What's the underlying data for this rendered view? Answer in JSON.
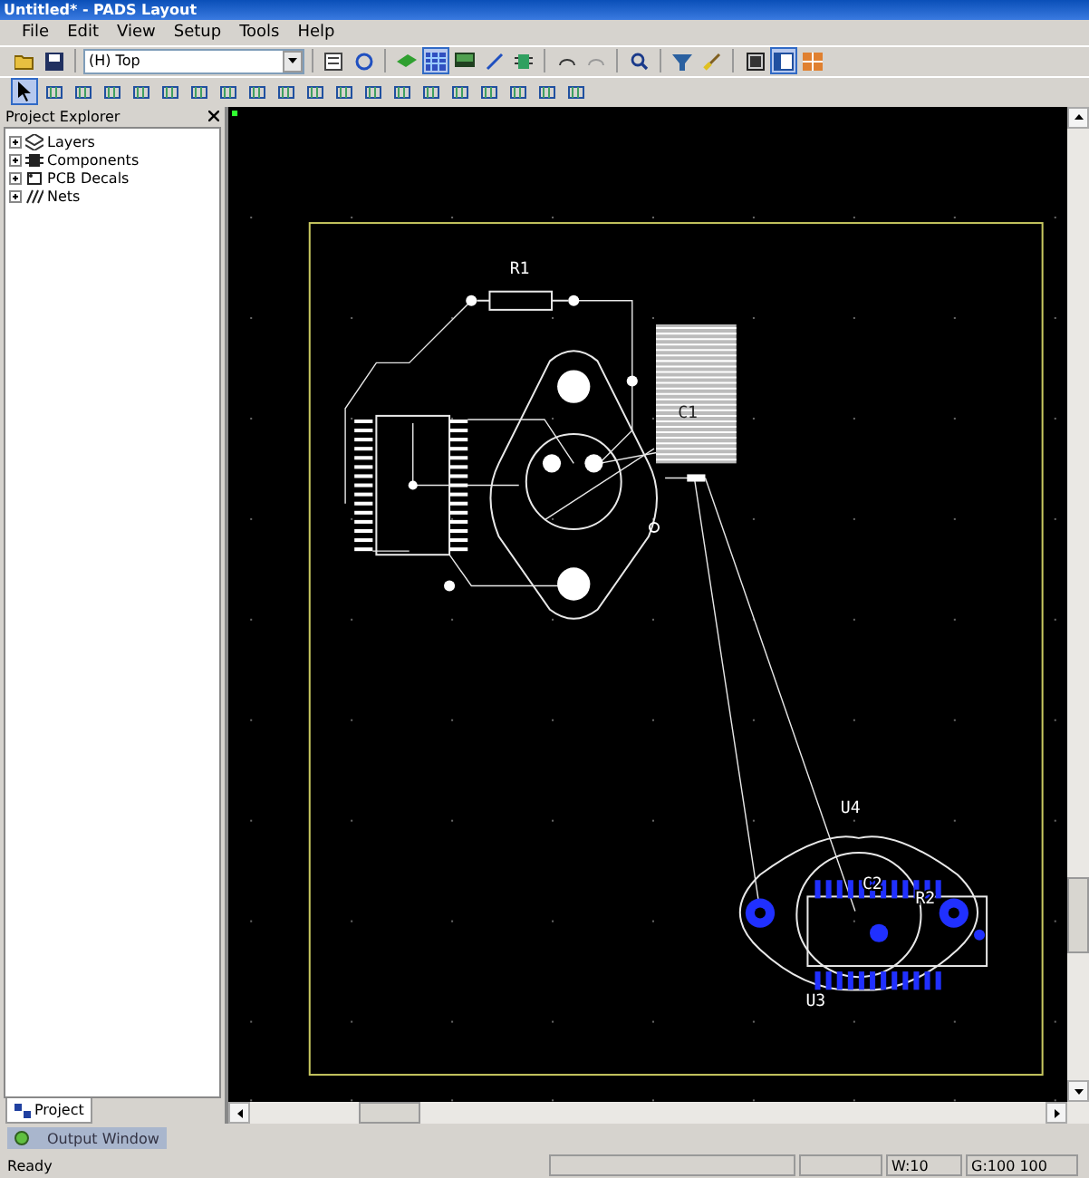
{
  "window": {
    "title": "Untitled* - PADS Layout"
  },
  "menu": [
    "File",
    "Edit",
    "View",
    "Setup",
    "Tools",
    "Help"
  ],
  "toolbar_1": [
    {
      "kind": "open",
      "pressed": false
    },
    {
      "kind": "save",
      "pressed": false
    },
    {
      "kind": "sep"
    },
    {
      "kind": "layer"
    },
    {
      "kind": "sep"
    },
    {
      "kind": "props",
      "pressed": false
    },
    {
      "kind": "refresh",
      "pressed": false
    },
    {
      "kind": "sep"
    },
    {
      "kind": "board",
      "pressed": false
    },
    {
      "kind": "grid",
      "pressed": true
    },
    {
      "kind": "display",
      "pressed": false
    },
    {
      "kind": "route",
      "pressed": false
    },
    {
      "kind": "part",
      "pressed": false
    },
    {
      "kind": "sep"
    },
    {
      "kind": "undo",
      "pressed": false
    },
    {
      "kind": "redo",
      "pressed": false
    },
    {
      "kind": "sep"
    },
    {
      "kind": "zoom",
      "pressed": false
    },
    {
      "kind": "sep"
    },
    {
      "kind": "filter",
      "pressed": false
    },
    {
      "kind": "brush",
      "pressed": false
    },
    {
      "kind": "sep"
    },
    {
      "kind": "window",
      "pressed": false
    },
    {
      "kind": "panes",
      "pressed": true
    },
    {
      "kind": "tile",
      "pressed": false
    }
  ],
  "layer_select": {
    "value": "(H) Top"
  },
  "toolbar_2": [
    {
      "kind": "select",
      "pressed": true
    },
    {
      "kind": "tool",
      "pressed": false
    },
    {
      "kind": "tool",
      "pressed": false
    },
    {
      "kind": "tool",
      "pressed": false
    },
    {
      "kind": "tool",
      "pressed": false
    },
    {
      "kind": "tool",
      "pressed": false
    },
    {
      "kind": "tool",
      "pressed": false
    },
    {
      "kind": "tool",
      "pressed": false
    },
    {
      "kind": "tool",
      "pressed": false
    },
    {
      "kind": "tool",
      "pressed": false
    },
    {
      "kind": "tool",
      "pressed": false
    },
    {
      "kind": "tool",
      "pressed": false
    },
    {
      "kind": "tool",
      "pressed": false
    },
    {
      "kind": "tool",
      "pressed": false
    },
    {
      "kind": "tool",
      "pressed": false
    },
    {
      "kind": "tool",
      "pressed": false
    },
    {
      "kind": "tool",
      "pressed": false
    },
    {
      "kind": "tool",
      "pressed": false
    },
    {
      "kind": "tool",
      "pressed": false
    },
    {
      "kind": "tool",
      "pressed": false
    }
  ],
  "project_explorer": {
    "title": "Project Explorer",
    "items": [
      {
        "label": "Layers",
        "kind": "layers",
        "expanded": false
      },
      {
        "label": "Components",
        "kind": "components",
        "expanded": false
      },
      {
        "label": "PCB Decals",
        "kind": "decals",
        "expanded": false
      },
      {
        "label": "Nets",
        "kind": "nets",
        "expanded": false
      }
    ],
    "tab": "Project"
  },
  "canvas": {
    "labels": [
      "R1",
      "C1",
      "U4",
      "C2",
      "R2",
      "U3"
    ]
  },
  "output_window": {
    "title": "Output Window"
  },
  "status_bar": {
    "text": "Ready",
    "width": "W:10",
    "grid": "G:100 100"
  }
}
